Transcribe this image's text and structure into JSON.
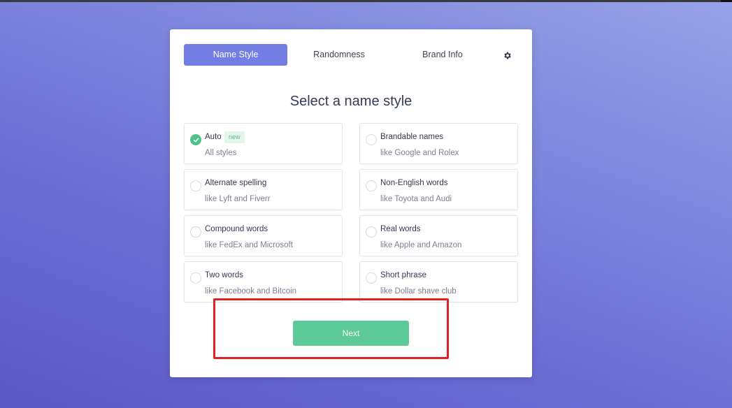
{
  "tabs": [
    {
      "label": "Name Style",
      "active": true
    },
    {
      "label": "Randomness",
      "active": false
    },
    {
      "label": "Brand Info",
      "active": false
    }
  ],
  "settings_icon": "gear-icon",
  "heading": "Select a name style",
  "options": [
    {
      "title": "Auto",
      "badge": "new",
      "subtitle": "All styles",
      "selected": true
    },
    {
      "title": "Brandable names",
      "subtitle": "like Google and Rolex",
      "selected": false
    },
    {
      "title": "Alternate spelling",
      "subtitle": "like Lyft and Fiverr",
      "selected": false
    },
    {
      "title": "Non-English words",
      "subtitle": "like Toyota and Audi",
      "selected": false
    },
    {
      "title": "Compound words",
      "subtitle": "like FedEx and Microsoft",
      "selected": false
    },
    {
      "title": "Real words",
      "subtitle": "like Apple and Amazon",
      "selected": false
    },
    {
      "title": "Two words",
      "subtitle": "like Facebook and Bitcoin",
      "selected": false
    },
    {
      "title": "Short phrase",
      "subtitle": "like Dollar shave club",
      "selected": false
    }
  ],
  "next_label": "Next",
  "colors": {
    "accent": "#727ee3",
    "success": "#5cc998",
    "highlight": "#e02222"
  }
}
